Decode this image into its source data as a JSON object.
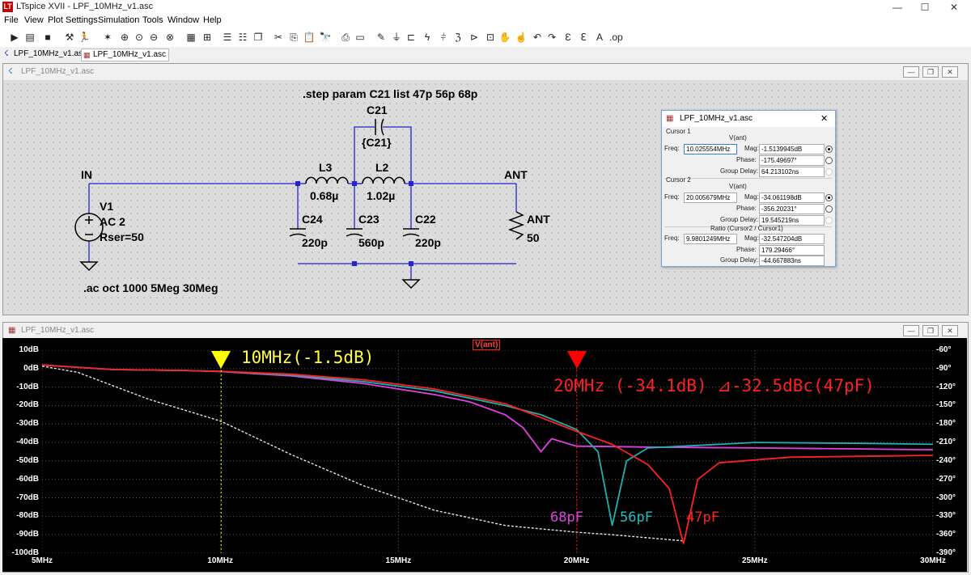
{
  "app": {
    "title": "LTspice XVII - LPF_10MHz_v1.asc"
  },
  "window_buttons": {
    "minimize": "—",
    "maximize": "☐",
    "close": "✕"
  },
  "menu": [
    "File",
    "View",
    "Plot Settings",
    "Simulation",
    "Tools",
    "Window",
    "Help"
  ],
  "tabs": [
    {
      "label": "LPF_10MHz_v1.asc",
      "icon": "schematic-icon"
    },
    {
      "label": "LPF_10MHz_v1.asc",
      "icon": "waveform-icon"
    }
  ],
  "schematic_window": {
    "title": "LPF_10MHz_v1.asc",
    "texts": {
      "step": ".step param C21 list 47p 56p 68p",
      "ac": ".ac oct 1000 5Meg 30Meg",
      "in": "IN",
      "ant_net": "ANT",
      "c21_name": "C21",
      "c21_val": "{C21}",
      "l3_name": "L3",
      "l3_val": "0.68µ",
      "l2_name": "L2",
      "l2_val": "1.02µ",
      "c24_name": "C24",
      "c24_val": "220p",
      "c23_name": "C23",
      "c23_val": "560p",
      "c22_name": "C22",
      "c22_val": "220p",
      "v1_name": "V1",
      "v1_val": "AC 2",
      "v1_rser": "Rser=50",
      "rl_name": "ANT",
      "rl_val": "50"
    }
  },
  "cursor_dialog": {
    "title": "LPF_10MHz_v1.asc",
    "close": "✕",
    "cursor1": {
      "header": "Cursor 1",
      "trace": "V(ant)",
      "freq": "10.025554MHz",
      "mag": "-1.5139945dB",
      "phase": "-175.49697°",
      "group_delay": "64.213102ns"
    },
    "cursor2": {
      "header": "Cursor 2",
      "trace": "V(ant)",
      "freq": "20.005679MHz",
      "mag": "-34.061198dB",
      "phase": "-356.20231°",
      "group_delay": "19.545219ns"
    },
    "ratio": {
      "header": "Ratio (Cursor2 / Cursor1)",
      "freq": "9.9801249MHz",
      "mag": "-32.547204dB",
      "phase": "179.29466°",
      "group_delay": "-44.667883ns"
    },
    "labels": {
      "freq": "Freq:",
      "mag": "Mag:",
      "phase": "Phase:",
      "group_delay": "Group Delay:"
    }
  },
  "waveform_window": {
    "title": "LPF_10MHz_v1.asc",
    "trace_label": "V(ant)",
    "cursor1_note": "10MHz(-1.5dB)",
    "cursor2_note": "20MHz (-34.1dB) ⊿-32.5dBc(47pF)",
    "notch_labels": [
      "68pF",
      "56pF",
      "47pF"
    ]
  },
  "chart_data": {
    "type": "line",
    "title": "V(ant)",
    "xscale": "linear",
    "xlim": [
      5,
      30
    ],
    "xunit": "MHz",
    "ylim_left": [
      -100,
      10
    ],
    "ylim_right": [
      -390,
      -60
    ],
    "grid": true,
    "x_ticks": [
      "5MHz",
      "10MHz",
      "15MHz",
      "20MHz",
      "25MHz",
      "30MHz"
    ],
    "y_ticks_left": [
      "10dB",
      "0dB",
      "-10dB",
      "-20dB",
      "-30dB",
      "-40dB",
      "-50dB",
      "-60dB",
      "-70dB",
      "-80dB",
      "-90dB",
      "-100dB"
    ],
    "y_ticks_right": [
      "-60°",
      "-90°",
      "-120°",
      "-150°",
      "-180°",
      "-210°",
      "-240°",
      "-270°",
      "-300°",
      "-330°",
      "-360°",
      "-390°"
    ],
    "magnitude_series": [
      {
        "name": "68pF",
        "color": "#e040e0",
        "x": [
          5,
          7,
          9,
          10,
          12,
          14,
          16,
          17,
          18,
          18.5,
          19.0,
          19.3,
          20,
          22,
          25,
          28,
          30
        ],
        "y": [
          2,
          -0.5,
          -1,
          -1.6,
          -4,
          -8,
          -14,
          -18,
          -25,
          -32,
          -45,
          -38,
          -42,
          -42.5,
          -43,
          -43.5,
          -44
        ]
      },
      {
        "name": "56pF",
        "color": "#20b0b0",
        "x": [
          5,
          7,
          9,
          10,
          12,
          14,
          16,
          18,
          19,
          20,
          20.6,
          21.0,
          21.4,
          22,
          25,
          28,
          30
        ],
        "y": [
          2,
          -0.5,
          -1,
          -1.5,
          -3.5,
          -7,
          -12,
          -20,
          -25,
          -33,
          -45,
          -85,
          -50,
          -43,
          -40,
          -40.5,
          -41
        ]
      },
      {
        "name": "47pF",
        "color": "#ff2020",
        "x": [
          5,
          7,
          9,
          10,
          12,
          14,
          16,
          18,
          20,
          21,
          22,
          22.6,
          23.0,
          23.4,
          24,
          26,
          28,
          30
        ],
        "y": [
          2,
          -0.5,
          -1,
          -1.5,
          -3,
          -6,
          -11,
          -19,
          -34,
          -41,
          -52,
          -65,
          -95,
          -60,
          -51,
          -48,
          -47.5,
          -47
        ]
      }
    ],
    "phase_series": [
      {
        "name": "phase",
        "color": "#e6e6e6",
        "x": [
          5,
          6,
          8,
          10,
          12,
          14,
          16,
          18,
          20,
          21,
          23
        ],
        "y": [
          -86,
          -96,
          -140,
          -175,
          -230,
          -280,
          -320,
          -345,
          -356,
          -360,
          -370
        ]
      }
    ],
    "cursors": [
      {
        "name": "Cursor 1",
        "x": 10.025554,
        "color": "#ffff00"
      },
      {
        "name": "Cursor 2",
        "x": 20.005679,
        "color": "#ff0000"
      }
    ]
  }
}
